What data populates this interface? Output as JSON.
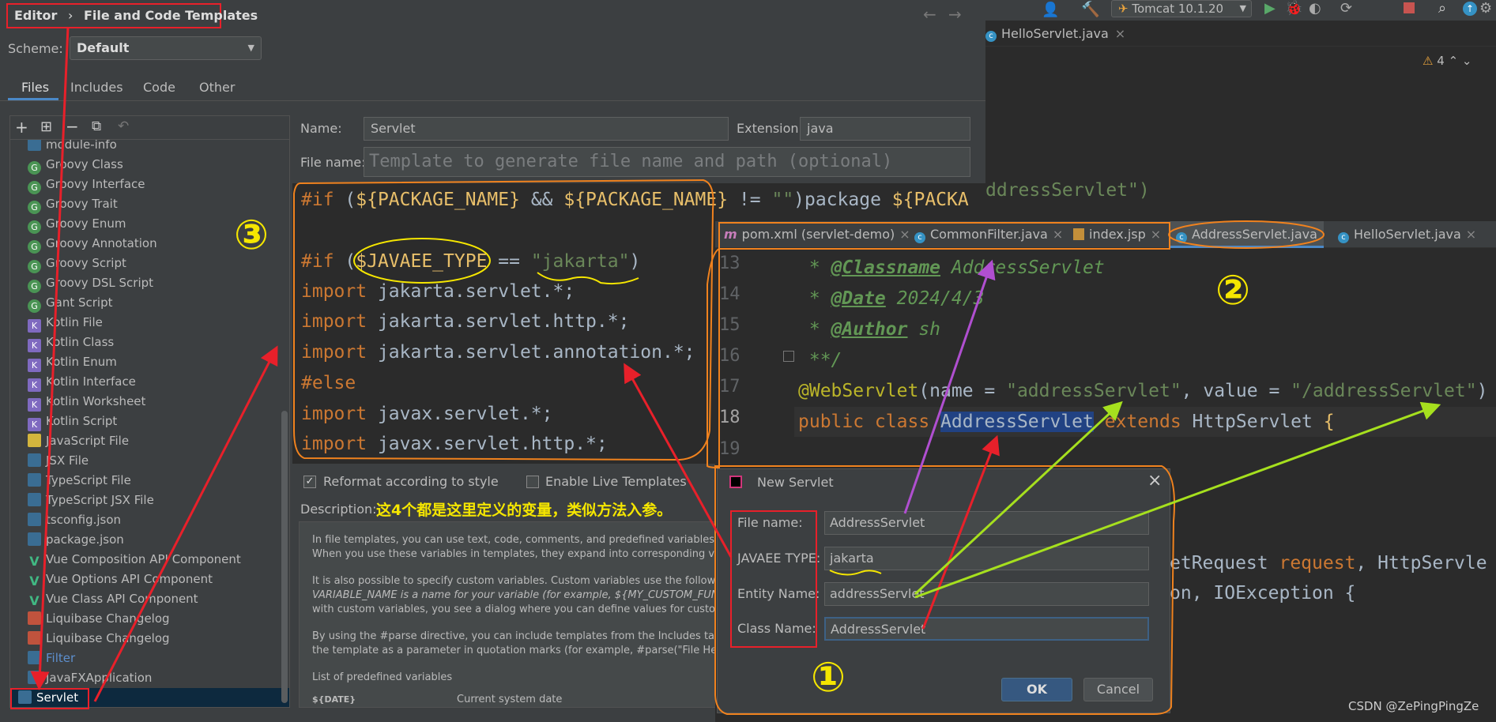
{
  "breadcrumb": {
    "root": "Editor",
    "sep": "›",
    "page": "File and Code Templates"
  },
  "scheme": {
    "label": "Scheme:",
    "value": "Default"
  },
  "top_tabs": [
    "Files",
    "Includes",
    "Code",
    "Other"
  ],
  "templates": [
    {
      "label": "module-info",
      "icon": "f"
    },
    {
      "label": "Groovy Class",
      "icon": "g"
    },
    {
      "label": "Groovy Interface",
      "icon": "g"
    },
    {
      "label": "Groovy Trait",
      "icon": "g"
    },
    {
      "label": "Groovy Enum",
      "icon": "g"
    },
    {
      "label": "Groovy Annotation",
      "icon": "g"
    },
    {
      "label": "Groovy Script",
      "icon": "g"
    },
    {
      "label": "Groovy DSL Script",
      "icon": "g"
    },
    {
      "label": "Gant Script",
      "icon": "g"
    },
    {
      "label": "Kotlin File",
      "icon": "k"
    },
    {
      "label": "Kotlin Class",
      "icon": "k"
    },
    {
      "label": "Kotlin Enum",
      "icon": "k"
    },
    {
      "label": "Kotlin Interface",
      "icon": "k"
    },
    {
      "label": "Kotlin Worksheet",
      "icon": "k"
    },
    {
      "label": "Kotlin Script",
      "icon": "k"
    },
    {
      "label": "JavaScript File",
      "icon": "js"
    },
    {
      "label": "JSX File",
      "icon": "f"
    },
    {
      "label": "TypeScript File",
      "icon": "f"
    },
    {
      "label": "TypeScript JSX File",
      "icon": "f"
    },
    {
      "label": "tsconfig.json",
      "icon": "f"
    },
    {
      "label": "package.json",
      "icon": "f"
    },
    {
      "label": "Vue Composition API Component",
      "icon": "v"
    },
    {
      "label": "Vue Options API Component",
      "icon": "v"
    },
    {
      "label": "Vue Class API Component",
      "icon": "v"
    },
    {
      "label": "Liquibase Changelog",
      "icon": "lb"
    },
    {
      "label": "Liquibase Changelog",
      "icon": "lb"
    },
    {
      "label": "Filter",
      "icon": "f"
    },
    {
      "label": "JavaFXApplication",
      "icon": "f"
    },
    {
      "label": "Servlet",
      "icon": "f"
    }
  ],
  "form": {
    "name_label": "Name:",
    "name_value": "Servlet",
    "ext_label": "Extension:",
    "ext_value": "java",
    "filename_label": "File name:",
    "filename_placeholder": "Template to generate file name and path (optional)"
  },
  "template_code": {
    "l1a": "#if",
    "l1b": " (",
    "l1c": "${PACKAGE_NAME}",
    "l1d": " && ",
    "l1e": "${PACKAGE_NAME}",
    "l1f": " != ",
    "l1g": "\"\"",
    "l1h": ")package ",
    "l1i": "${PACKA",
    "l3a": "#if",
    "l3b": " (",
    "l3c": "$JAVAEE_TYPE",
    "l3d": " == ",
    "l3e": "\"jakarta\"",
    "l3f": ")",
    "l4a": "import",
    "l4b": " jakarta.servlet.*;",
    "l5a": "import",
    "l5b": " jakarta.servlet.http.*;",
    "l6a": "import",
    "l6b": " jakarta.servlet.annotation.*;",
    "l7": "#else",
    "l8a": "import",
    "l8b": " javax.servlet.*;",
    "l9a": "import",
    "l9b": " javax.servlet.http.*;"
  },
  "options": {
    "reformat": "Reformat according to style",
    "live": "Enable Live Templates"
  },
  "description": {
    "label": "Description:",
    "note": "这4个都是这里定义的变量，类似方法入参。",
    "p1": "In file templates, you can use text, code, comments, and predefined variables. A",
    "p1b": "When you use these variables in templates, they expand into corresponding valu",
    "p2": "It is also possible to specify custom variables. Custom variables use the following",
    "p2b": "VARIABLE_NAME is a name for your variable (for example, ${MY_CUSTOM_FUNCTIO",
    "p2c": "with custom variables, you see a dialog where you can define values for custom v",
    "p3": "By using the #parse directive, you can include templates from the Includes tab. T",
    "p3b": "the template as a parameter in quotation marks (for example, #parse(\"File Header",
    "p4": "List of predefined variables",
    "var_name": "${DATE}",
    "var_desc": "Current system date"
  },
  "ide": {
    "run_config": "Tomcat 10.1.20",
    "top_file_tab": "HelloServlet.java",
    "warnings": "4",
    "bg_code": "ddressServlet\")",
    "tabs": [
      "pom.xml (servlet-demo)",
      "CommonFilter.java",
      "index.jsp",
      "AddressServlet.java",
      "HelloServlet.java"
    ],
    "gutter": [
      "13",
      "14",
      "15",
      "16",
      "17",
      "18",
      "19"
    ],
    "l13a": " * ",
    "l13b": "@Classname",
    "l13c": " AddressServlet",
    "l14a": " * ",
    "l14b": "@Date",
    "l14c": " 2024/4/3",
    "l15a": " * ",
    "l15b": "@Author",
    "l15c": " sh",
    "l16": " **/",
    "l17a": "@WebServlet",
    "l17b": "(name = ",
    "l17c": "\"addressServlet\"",
    "l17d": ", value = ",
    "l17e": "\"/addressServlet\"",
    "l17f": ")",
    "l18a": "public class ",
    "l18b": "AddressServlet",
    "l18c": " extends ",
    "l18d": "HttpServlet",
    "l18e": " {",
    "bg2a": "etRequest ",
    "bg2b": "request",
    "bg2c": ", HttpServle",
    "bg3a": "on, IOException {"
  },
  "dialog": {
    "title": "New Servlet",
    "file_name_label": "File name:",
    "file_name_value": "AddressServlet",
    "type_label": "JAVAEE TYPE:",
    "type_value": "jakarta",
    "entity_label": "Entity Name:",
    "entity_value": "addressServlet",
    "class_label": "Class Name:",
    "class_value": "AddressServlet",
    "ok": "OK",
    "cancel": "Cancel"
  },
  "markers": {
    "one": "①",
    "two": "②",
    "three": "③"
  },
  "watermark": "CSDN @ZePingPingZe",
  "colors": {
    "annotation_red": "#e8202a",
    "annotation_orange": "#f0821e",
    "annotation_yellow": "#f5e600",
    "annotation_green": "#a6e01e",
    "annotation_purple": "#b04fd0"
  }
}
